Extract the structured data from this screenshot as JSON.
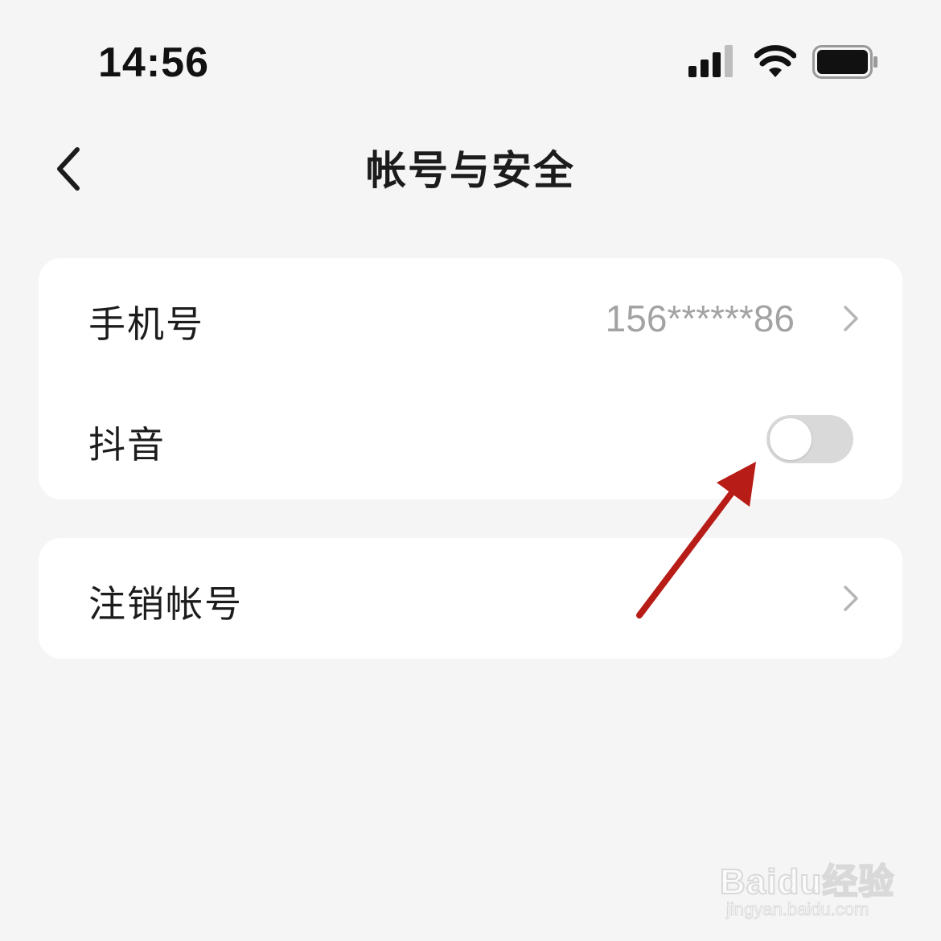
{
  "status_bar": {
    "time": "14:56",
    "icons": [
      "cellular-signal-icon",
      "wifi-icon",
      "battery-icon"
    ]
  },
  "nav": {
    "title": "帐号与安全",
    "back_icon": "chevron-left-icon"
  },
  "settings": {
    "group1": {
      "phone": {
        "label": "手机号",
        "value": "156******86"
      },
      "douyin": {
        "label": "抖音",
        "toggle_on": false
      }
    },
    "group2": {
      "deactivate": {
        "label": "注销帐号"
      }
    }
  },
  "watermark": {
    "logo": "Baidu经验",
    "url": "jingyan.baidu.com"
  },
  "colors": {
    "background": "#f5f5f5",
    "card": "#ffffff",
    "toggle_off": "#d9d9d9",
    "secondary_text": "#a3a3a3",
    "annotation_arrow": "#b81c17"
  }
}
